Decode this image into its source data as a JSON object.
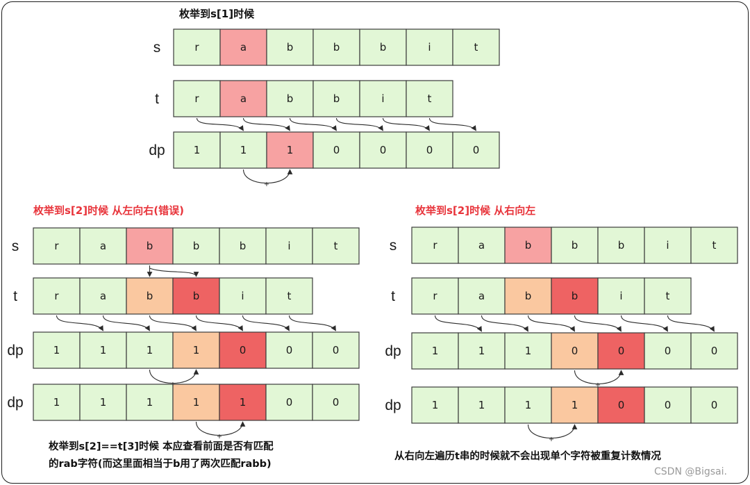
{
  "colors": {
    "cell_default": "#e2f7d6",
    "cell_highlight_pink": "#f7a2a2",
    "cell_highlight_orange": "#fac8a0",
    "cell_highlight_red": "#ee6363",
    "title_red": "#e8343b",
    "border": "#3b3b3b"
  },
  "icons": [
    "arrow-connector-icon",
    "plus-icon"
  ],
  "panel_top": {
    "title": "枚举到s[1]时候",
    "rows": [
      {
        "label": "s",
        "cells": [
          "r",
          "a",
          "b",
          "b",
          "b",
          "i",
          "t"
        ],
        "fills": [
          "g",
          "p1",
          "g",
          "g",
          "g",
          "g",
          "g"
        ]
      },
      {
        "label": "t",
        "cells": [
          "r",
          "a",
          "b",
          "b",
          "i",
          "t"
        ],
        "fills": [
          "g",
          "p1",
          "g",
          "g",
          "g",
          "g"
        ]
      },
      {
        "label": "dp",
        "cells": [
          "1",
          "1",
          "1",
          "0",
          "0",
          "0",
          "0"
        ],
        "fills": [
          "g",
          "g",
          "p1",
          "g",
          "g",
          "g",
          "g"
        ]
      }
    ]
  },
  "panel_left": {
    "title": "枚举到s[2]时候 从左向右(错误)",
    "rows": [
      {
        "label": "s",
        "cells": [
          "r",
          "a",
          "b",
          "b",
          "b",
          "i",
          "t"
        ],
        "fills": [
          "g",
          "g",
          "p1",
          "g",
          "g",
          "g",
          "g"
        ]
      },
      {
        "label": "t",
        "cells": [
          "r",
          "a",
          "b",
          "b",
          "i",
          "t"
        ],
        "fills": [
          "g",
          "g",
          "p2",
          "p3",
          "g",
          "g"
        ]
      },
      {
        "label": "dp",
        "cells": [
          "1",
          "1",
          "1",
          "1",
          "0",
          "0",
          "0"
        ],
        "fills": [
          "g",
          "g",
          "g",
          "p2",
          "p3",
          "g",
          "g"
        ]
      },
      {
        "label": "dp",
        "cells": [
          "1",
          "1",
          "1",
          "1",
          "1",
          "0",
          "0"
        ],
        "fills": [
          "g",
          "g",
          "g",
          "p2",
          "p3",
          "g",
          "g"
        ]
      }
    ],
    "note_line1": "枚举到s[2]==t[3]时候 本应查看前面是否有匹配",
    "note_line2": "的rab字符(而这里面相当于b用了两次匹配rabb)"
  },
  "panel_right": {
    "title": "枚举到s[2]时候 从右向左",
    "rows": [
      {
        "label": "s",
        "cells": [
          "r",
          "a",
          "b",
          "b",
          "b",
          "i",
          "t"
        ],
        "fills": [
          "g",
          "g",
          "p1",
          "g",
          "g",
          "g",
          "g"
        ]
      },
      {
        "label": "t",
        "cells": [
          "r",
          "a",
          "b",
          "b",
          "i",
          "t"
        ],
        "fills": [
          "g",
          "g",
          "p2",
          "p3",
          "g",
          "g"
        ]
      },
      {
        "label": "dp",
        "cells": [
          "1",
          "1",
          "1",
          "0",
          "0",
          "0",
          "0"
        ],
        "fills": [
          "g",
          "g",
          "g",
          "p2",
          "p3",
          "g",
          "g"
        ]
      },
      {
        "label": "dp",
        "cells": [
          "1",
          "1",
          "1",
          "1",
          "0",
          "0",
          "0"
        ],
        "fills": [
          "g",
          "g",
          "g",
          "p2",
          "p3",
          "g",
          "g"
        ]
      }
    ],
    "note": "从右向左遍历t串的时候就不会出现单个字符被重复计数情况"
  },
  "plus_sign": "+",
  "watermark": "CSDN @Bigsai."
}
